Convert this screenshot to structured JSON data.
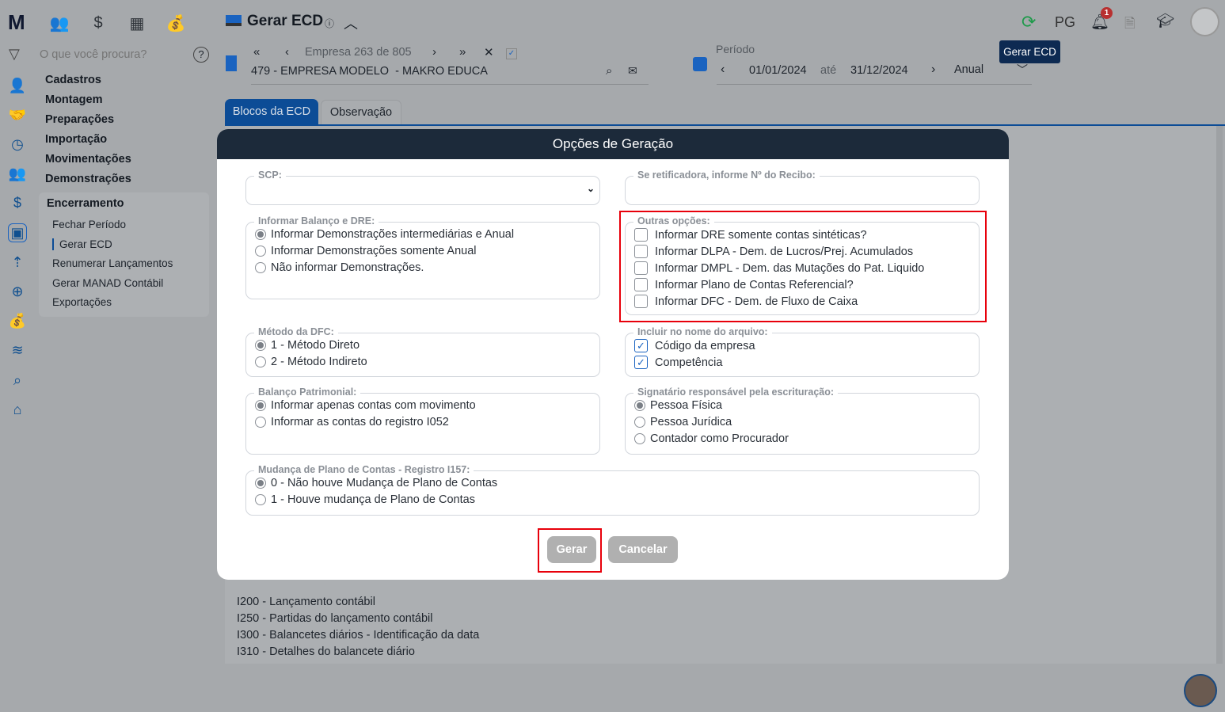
{
  "app": {
    "logo": "M",
    "top_icons": [
      "people-icon",
      "dollar-icon",
      "calculator-icon",
      "money-bag-icon"
    ]
  },
  "search": {
    "placeholder": "O que você procura?"
  },
  "sidebar": {
    "menu": [
      "Cadastros",
      "Montagem",
      "Preparações",
      "Importação",
      "Movimentações",
      "Demonstrações"
    ],
    "section": "Encerramento",
    "sub_items": [
      "Fechar Período",
      "Gerar ECD",
      "Renumerar Lançamentos",
      "Gerar MANAD Contábil",
      "Exportações"
    ],
    "active_sub": 1
  },
  "header": {
    "title": "Gerar ECD",
    "user_initials": "PG",
    "notification_count": "1",
    "tooltip": "Gerar ECD"
  },
  "company": {
    "nav": "Empresa 263 de 805",
    "name": "479 - EMPRESA MODELO  - MAKRO EDUCA"
  },
  "period": {
    "label": "Período",
    "start": "01/01/2024",
    "sep": "até",
    "end": "31/12/2024",
    "type": "Anual"
  },
  "tabs": [
    "Blocos da ECD",
    "Observação"
  ],
  "background_list": [
    "I200 - Lançamento contábil",
    "I250 - Partidas do lançamento contábil",
    "I300 - Balancetes diários - Identificação da data",
    "I310 - Detalhes do balancete diário"
  ],
  "modal": {
    "title": "Opções de Geração",
    "scp": {
      "label": "SCP:",
      "value": ""
    },
    "recibo": {
      "label": "Se retificadora, informe Nº do Recibo:",
      "value": ""
    },
    "groups": [
      {
        "label": "Informar Balanço e DRE:",
        "type": "radio",
        "options": [
          "Informar Demonstrações intermediárias e Anual",
          "Informar Demonstrações somente Anual",
          "Não informar Demonstrações."
        ],
        "checked": [
          true,
          false,
          false
        ]
      },
      {
        "label": "Outras opções:",
        "type": "check",
        "options": [
          "Informar DRE somente contas sintéticas?",
          "Informar DLPA - Dem. de Lucros/Prej. Acumulados",
          "Informar DMPL - Dem. das Mutações do Pat. Liquido",
          "Informar Plano de Contas Referencial?",
          "Informar DFC - Dem. de Fluxo de Caixa"
        ],
        "checked": [
          false,
          false,
          false,
          false,
          false
        ]
      },
      {
        "label": "Método da DFC:",
        "type": "radio",
        "options": [
          "1 - Método Direto",
          "2 - Método Indireto"
        ],
        "checked": [
          true,
          false
        ]
      },
      {
        "label": "Incluir no nome do arquivo:",
        "type": "check",
        "options": [
          "Código da empresa",
          "Competência"
        ],
        "checked": [
          true,
          true
        ]
      },
      {
        "label": "Balanço Patrimonial:",
        "type": "radio",
        "options": [
          "Informar apenas contas com movimento",
          "Informar as contas do registro I052"
        ],
        "checked": [
          true,
          false
        ]
      },
      {
        "label": "Signatário responsável pela escrituração:",
        "type": "radio",
        "options": [
          "Pessoa Física",
          "Pessoa Jurídica",
          "Contador como Procurador"
        ],
        "checked": [
          true,
          false,
          false
        ]
      },
      {
        "label": "Mudança de Plano de Contas - Registro I157:",
        "type": "radio",
        "options": [
          "0 - Não houve Mudança de Plano de Contas",
          "1 - Houve mudança de Plano de Contas"
        ],
        "checked": [
          true,
          false
        ]
      }
    ],
    "buttons": {
      "generate": "Gerar",
      "cancel": "Cancelar"
    }
  }
}
